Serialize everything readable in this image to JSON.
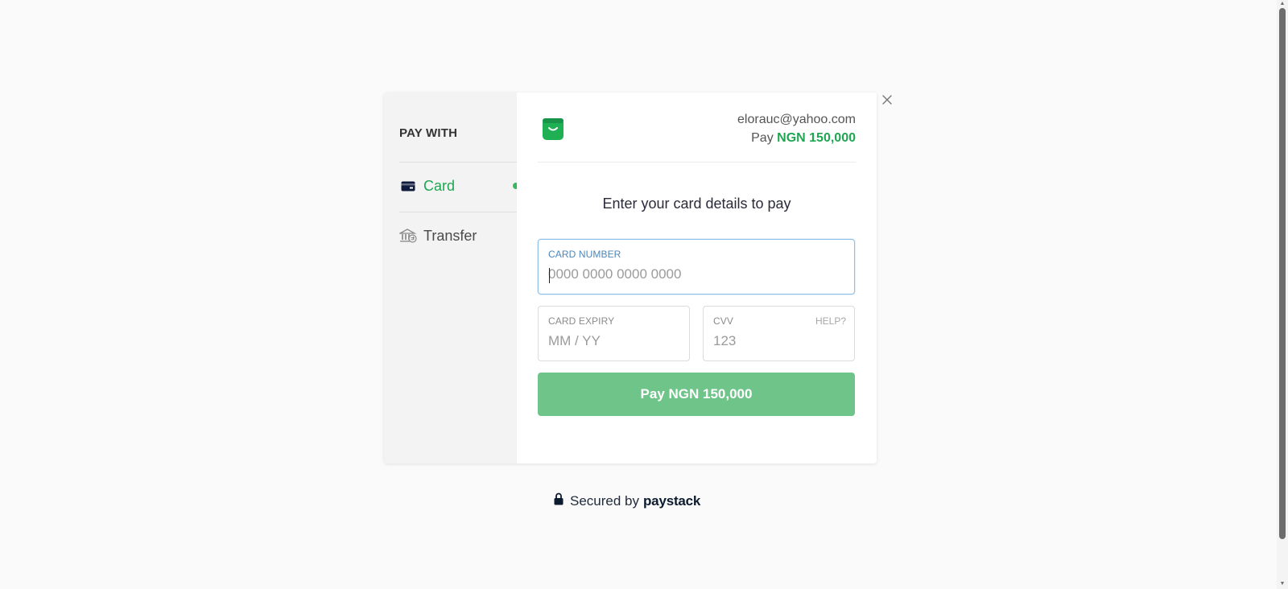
{
  "sidebar": {
    "title": "PAY WITH",
    "items": [
      {
        "label": "Card",
        "icon": "card-icon",
        "active": true
      },
      {
        "label": "Transfer",
        "icon": "bank-transfer-icon",
        "active": false
      }
    ]
  },
  "header": {
    "email": "elorauc@yahoo.com",
    "pay_prefix": "Pay",
    "amount": "NGN 150,000"
  },
  "form": {
    "prompt": "Enter your card details to pay",
    "card_number": {
      "label": "CARD NUMBER",
      "placeholder": "0000 0000 0000 0000",
      "value": ""
    },
    "card_expiry": {
      "label": "CARD EXPIRY",
      "placeholder": "MM / YY",
      "value": ""
    },
    "cvv": {
      "label": "CVV",
      "help": "HELP?",
      "placeholder": "123",
      "value": ""
    },
    "pay_button": "Pay NGN 150,000"
  },
  "footer": {
    "secured_prefix": "Secured by",
    "brand": "paystack"
  },
  "colors": {
    "accent": "#1fa652",
    "button": "#6fc48a",
    "focus": "#8fc0e6"
  }
}
